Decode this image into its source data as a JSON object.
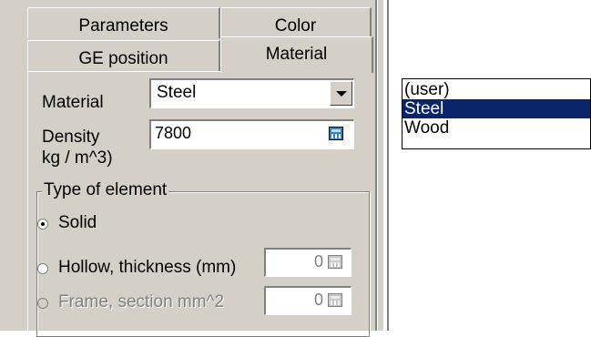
{
  "tabs": {
    "row1": [
      "Parameters",
      "Color"
    ],
    "row2": [
      "GE position",
      "Material"
    ],
    "active": "Material"
  },
  "material": {
    "label": "Material",
    "selected": "Steel"
  },
  "density": {
    "label_line1": "Density",
    "label_line2": " kg  / m^3)",
    "value": "7800",
    "icon": "calculator-icon"
  },
  "element_type": {
    "title": "Type of element",
    "options": [
      {
        "label": "Solid",
        "checked": true,
        "enabled": true
      },
      {
        "label": "Hollow, thickness (mm)",
        "checked": false,
        "enabled": true,
        "value": "0"
      },
      {
        "label": "Frame, section mm^2",
        "checked": false,
        "enabled": false,
        "value": "0"
      }
    ]
  },
  "dropdown_list": {
    "items": [
      "(user)",
      "Steel",
      "Wood"
    ],
    "selected_index": 1
  },
  "colors": {
    "panel": "#d4d0c8",
    "selection": "#0a246a"
  }
}
